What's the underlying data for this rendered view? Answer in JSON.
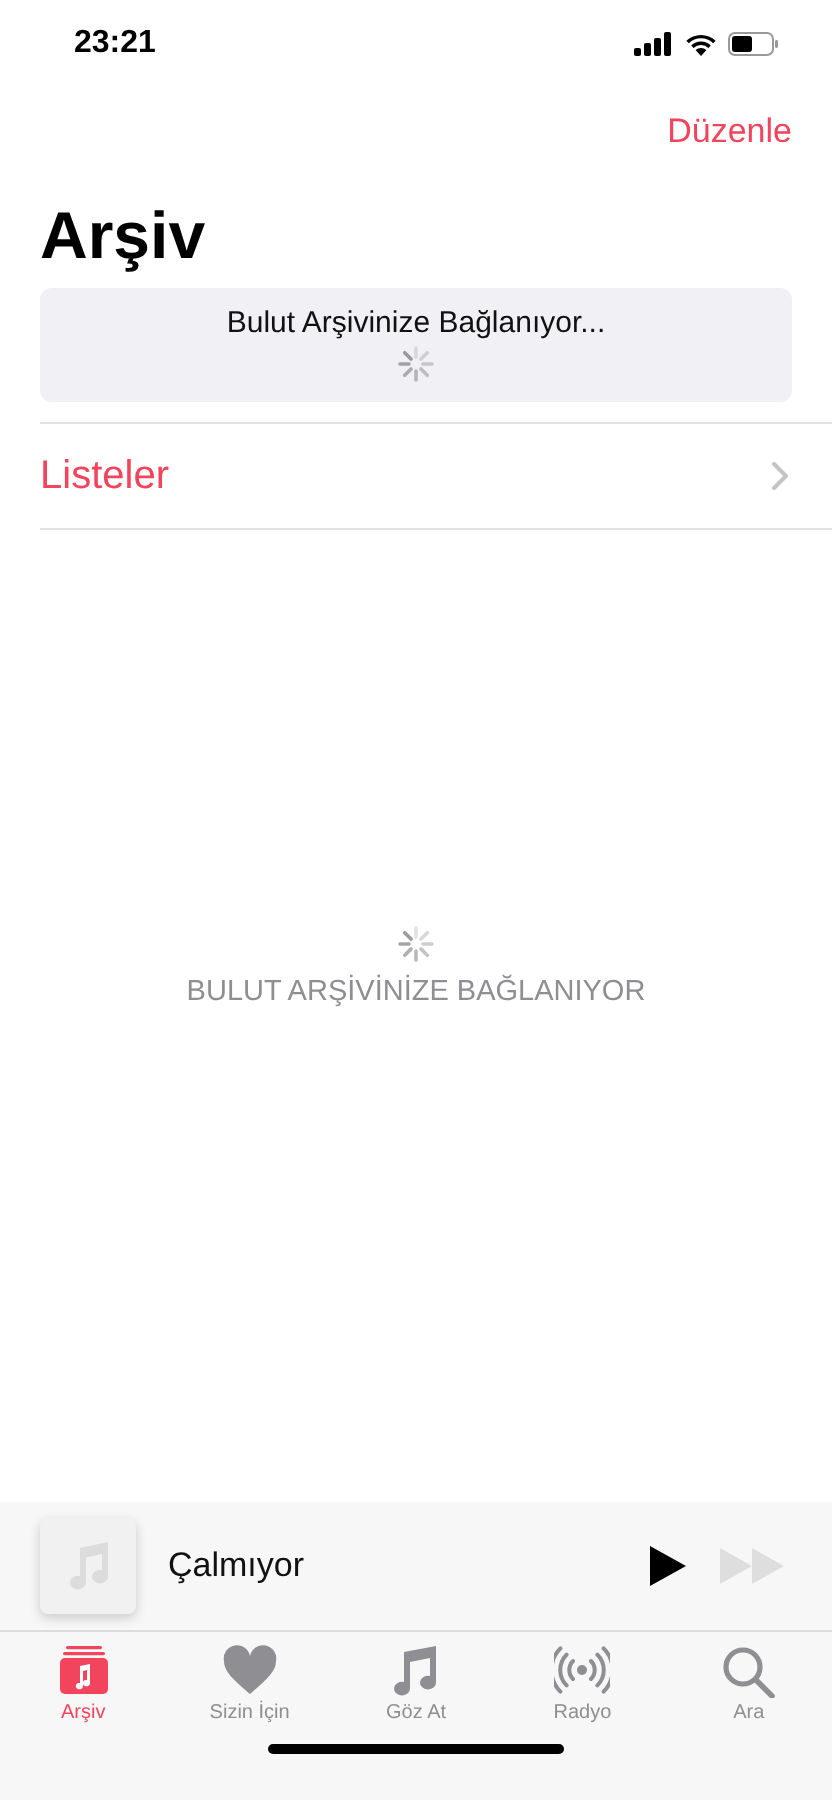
{
  "status_bar": {
    "time": "23:21"
  },
  "nav": {
    "edit_button": "Düzenle",
    "title": "Arşiv"
  },
  "banner": {
    "message": "Bulut Arşivinize Bağlanıyor..."
  },
  "list": [
    {
      "label": "Listeler"
    }
  ],
  "empty_state": {
    "message": "BULUT ARŞİVİNİZE BAĞLANIYOR"
  },
  "mini_player": {
    "title": "Çalmıyor",
    "controls": [
      {
        "kind": "play",
        "disabled": false
      },
      {
        "kind": "forward",
        "disabled": true
      }
    ]
  },
  "tabs": [
    {
      "kind": "library",
      "label": "Arşiv",
      "selected": true
    },
    {
      "kind": "heart",
      "label": "Sizin İçin",
      "selected": false
    },
    {
      "kind": "note",
      "label": "Göz At",
      "selected": false
    },
    {
      "kind": "radio",
      "label": "Radyo",
      "selected": false
    },
    {
      "kind": "search",
      "label": "Ara",
      "selected": false
    }
  ]
}
